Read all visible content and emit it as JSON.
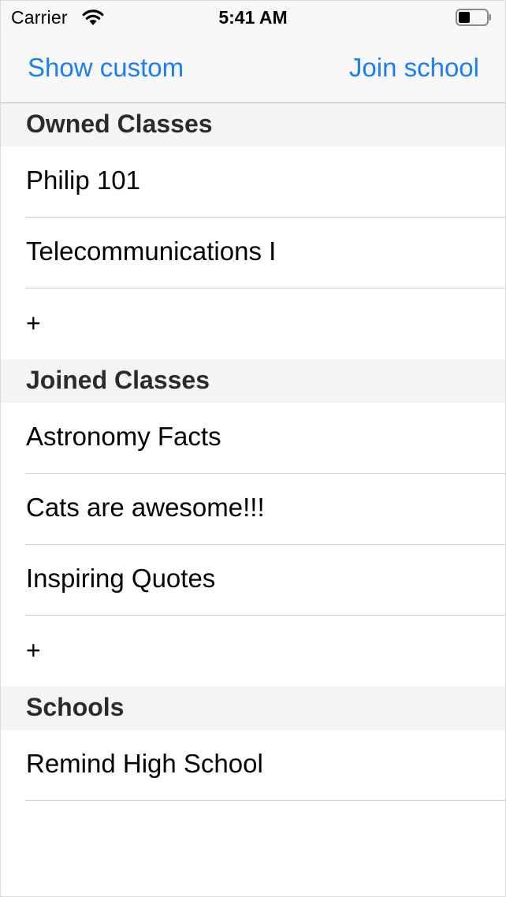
{
  "status_bar": {
    "carrier": "Carrier",
    "time": "5:41 AM"
  },
  "nav": {
    "left_button": "Show custom",
    "right_button": "Join school"
  },
  "colors": {
    "accent": "#1a7ef5"
  },
  "sections": {
    "owned": {
      "title": "Owned Classes",
      "items": [
        "Philip 101",
        "Telecommunications I"
      ],
      "add_label": "+"
    },
    "joined": {
      "title": "Joined Classes",
      "items": [
        "Astronomy Facts",
        "Cats are awesome!!!",
        "Inspiring Quotes"
      ],
      "add_label": "+"
    },
    "schools": {
      "title": "Schools",
      "items": [
        "Remind High School"
      ]
    }
  }
}
